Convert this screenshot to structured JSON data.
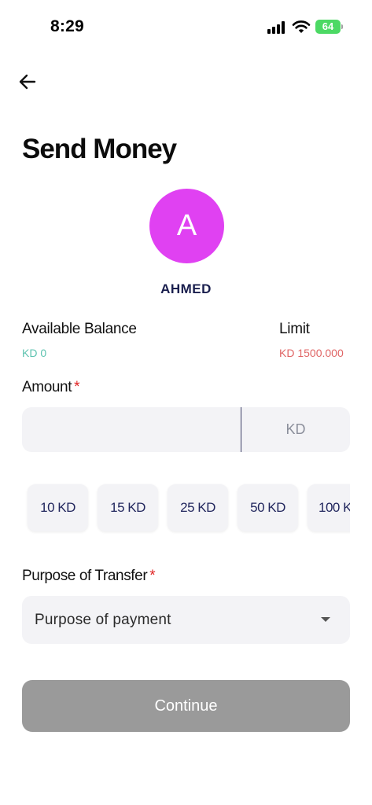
{
  "status_bar": {
    "time": "8:29",
    "battery": "64",
    "battery_color": "#4cd964"
  },
  "header": {
    "back_icon": "arrow-left-icon",
    "title": "Send Money"
  },
  "recipient": {
    "avatar_initial": "A",
    "avatar_color": "#e041f2",
    "name": "AHMED"
  },
  "balance": {
    "available_label": "Available Balance",
    "available_value": "KD 0",
    "available_color": "#5ec3b0",
    "limit_label": "Limit",
    "limit_value": "KD 1500.000",
    "limit_color": "#e06666"
  },
  "amount": {
    "label": "Amount",
    "required_mark": "*",
    "value": "",
    "currency": "KD"
  },
  "quick_amounts": [
    "10 KD",
    "15 KD",
    "25 KD",
    "50 KD",
    "100 K"
  ],
  "purpose": {
    "label": "Purpose of Transfer",
    "required_mark": "*",
    "selected": "Purpose of payment",
    "caret_icon": "caret-down-icon"
  },
  "actions": {
    "continue_label": "Continue",
    "continue_color": "#9a9a9a"
  }
}
